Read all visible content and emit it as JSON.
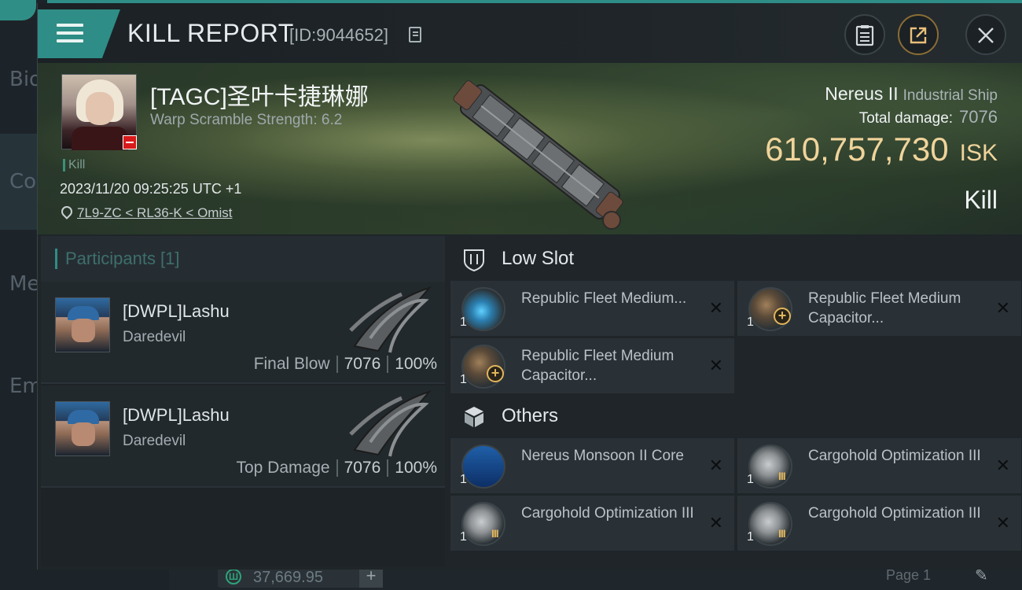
{
  "background": {
    "sidebar_items": [
      "Bio",
      "Co",
      "Me",
      "Em"
    ],
    "currency_value": "37,669.95",
    "pager": "Page 1"
  },
  "header": {
    "title": "KILL REPORT",
    "report_id": "[ID:9044652]"
  },
  "victim": {
    "name": "[TAGC]圣叶卡捷琳娜",
    "warp_scramble": "Warp Scramble Strength: 6.2",
    "tag": "Kill",
    "datetime": "2023/11/20 09:25:25 UTC +1",
    "location": "7L9-ZC < RL36-K < Omist"
  },
  "ship": {
    "name": "Nereus II",
    "class": "Industrial Ship",
    "total_damage_label": "Total damage:",
    "total_damage": "7076",
    "isk_value": "610,757,730",
    "isk_unit": "ISK",
    "result": "Kill"
  },
  "participants": {
    "title": "Participants [1]",
    "rows": [
      {
        "name": "[DWPL]Lashu",
        "ship": "Daredevil",
        "label": "Final Blow",
        "damage": "7076",
        "percent": "100%"
      },
      {
        "name": "[DWPL]Lashu",
        "ship": "Daredevil",
        "label": "Top Damage",
        "damage": "7076",
        "percent": "100%"
      }
    ]
  },
  "low_slot": {
    "title": "Low Slot",
    "items": [
      {
        "qty": "1",
        "name": "Republic Fleet Medium...",
        "icon": "module-blue-icon"
      },
      {
        "qty": "1",
        "name": "Republic Fleet Medium Capacitor...",
        "icon": "capacitor-icon"
      },
      {
        "qty": "1",
        "name": "Republic Fleet Medium Capacitor...",
        "icon": "capacitor-icon"
      }
    ]
  },
  "others": {
    "title": "Others",
    "items": [
      {
        "qty": "1",
        "name": "Nereus Monsoon II Core",
        "icon": "core-icon"
      },
      {
        "qty": "1",
        "name": "Cargohold Optimization III",
        "icon": "cargohold-icon"
      },
      {
        "qty": "1",
        "name": "Cargohold Optimization III",
        "icon": "cargohold-icon"
      },
      {
        "qty": "1",
        "name": "Cargohold Optimization III",
        "icon": "cargohold-icon"
      }
    ]
  },
  "colors": {
    "accent": "#2e8d86",
    "isk": "#f0d49b",
    "gold": "#e2b65c"
  }
}
